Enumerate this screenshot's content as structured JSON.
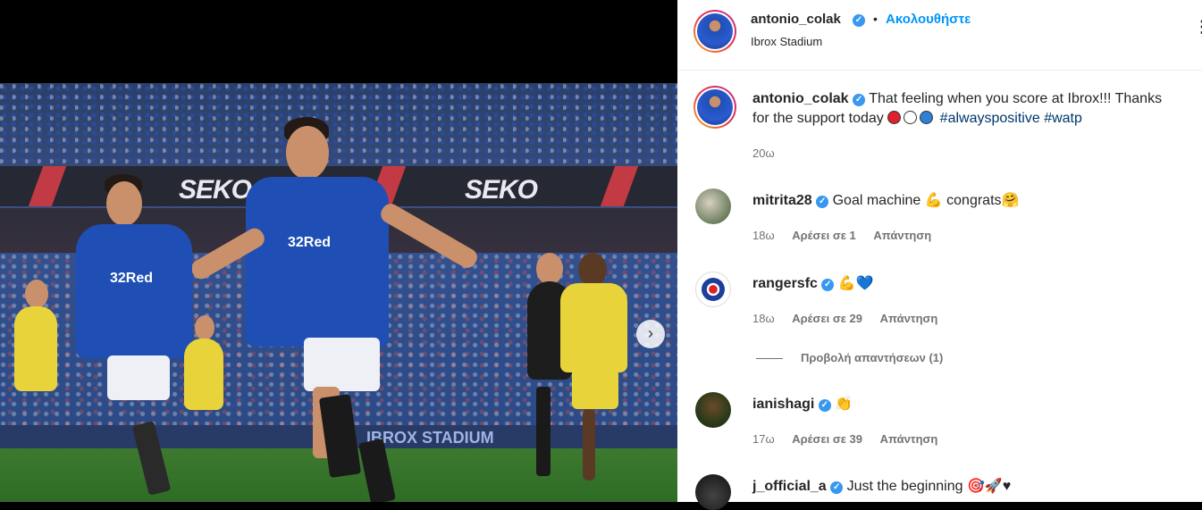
{
  "header": {
    "username": "antonio_colak",
    "follow_label": "Ακολουθήστε",
    "location": "Ibrox Stadium",
    "more": "⋮"
  },
  "caption": {
    "username": "antonio_colak",
    "text_part1": "That feeling when you score at Ibrox!!! Thanks",
    "text_part2": "for the support today",
    "hashtag1": "#alwayspositive",
    "hashtag2": "#watp",
    "time": "20ω"
  },
  "comments": [
    {
      "username": "mitrita28",
      "text1": "Goal machine",
      "emoji1": "💪",
      "text2": "congrats",
      "emoji2": "🤗",
      "time": "18ω",
      "likes": "Αρέσει σε 1",
      "reply": "Απάντηση"
    },
    {
      "username": "rangersfc",
      "emoji1": "💪",
      "emoji2": "💙",
      "time": "18ω",
      "likes": "Αρέσει σε 29",
      "reply": "Απάντηση"
    },
    {
      "username": "ianishagi",
      "emoji1": "👏",
      "time": "17ω",
      "likes": "Αρέσει σε 39",
      "reply": "Απάντηση"
    },
    {
      "username": "j_official_a",
      "text1": "Just the beginning",
      "emoji1": "🎯",
      "emoji2": "🚀",
      "emoji3": "♥"
    }
  ],
  "view_replies": "Προβολή απαντήσεων (1)",
  "photo": {
    "board_text_left": "SEKO",
    "board_text_right": "SEKO",
    "stadium_text": "IBROX STADIUM",
    "sponsor1": "32Red",
    "sponsor2": "32Red",
    "next_icon": "›"
  },
  "colors": {
    "link": "#0095f6",
    "verified": "#3897f0",
    "hashtag": "#00376b"
  }
}
